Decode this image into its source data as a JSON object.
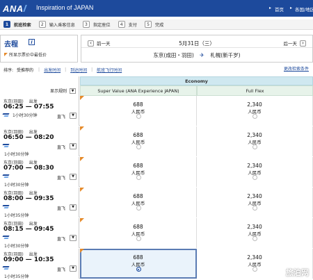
{
  "header": {
    "logo": "ANA",
    "title": "Inspiration of JAPAN",
    "nav_home": "首页",
    "nav_intl": "各国/地区"
  },
  "steps": [
    {
      "num": "1",
      "label": "航班检索",
      "active": true
    },
    {
      "num": "2",
      "label": "输入乘客信息",
      "active": false
    },
    {
      "num": "3",
      "label": "指定座位",
      "active": false
    },
    {
      "num": "4",
      "label": "支付",
      "active": false
    },
    {
      "num": "5",
      "label": "完成",
      "active": false
    }
  ],
  "outbound": {
    "title": "去程",
    "info_icon": "i",
    "lowfare_note": "所显示票价中最低价"
  },
  "date_bar": {
    "prev_label": "前一天",
    "next_label": "后一天",
    "current_date": "5月31日（三）",
    "origin": "东京(成田・羽田)",
    "destination": "札幌(新千岁)"
  },
  "sort_bar": {
    "label": "排序:",
    "current": "受推荐的",
    "links": [
      "出发时间",
      "到达时间",
      "航班飞行时间"
    ],
    "more": "更改检索条件"
  },
  "table": {
    "show_rule_label": "显示规则",
    "cabin": "Economy",
    "fare_types": [
      "Super Value (ANA Experience JAPAN)",
      "Full Flex"
    ]
  },
  "flights": [
    {
      "origin": "东京(羽田)",
      "kind": "出发",
      "times": "06:25 — 07:55",
      "nonstop": "直飞",
      "duration": "1小时30分钟",
      "super_price": "688",
      "super_currency": "人民币",
      "flex_price": "2,340",
      "flex_currency": "人民币"
    },
    {
      "origin": "东京(羽田)",
      "kind": "出发",
      "times": "06:50 — 08:20",
      "nonstop": "直飞",
      "duration": "1小时30分钟",
      "super_price": "688",
      "super_currency": "人民币",
      "flex_price": "2,340",
      "flex_currency": "人民币"
    },
    {
      "origin": "东京(羽田)",
      "kind": "出发",
      "times": "07:00 — 08:30",
      "nonstop": "直飞",
      "duration": "1小时30分钟",
      "super_price": "688",
      "super_currency": "人民币",
      "flex_price": "2,340",
      "flex_currency": "人民币"
    },
    {
      "origin": "东京(羽田)",
      "kind": "出发",
      "times": "08:00 — 09:35",
      "nonstop": "直飞",
      "duration": "1小时35分钟",
      "super_price": "688",
      "super_currency": "人民币",
      "flex_price": "2,340",
      "flex_currency": "人民币"
    },
    {
      "origin": "东京(羽田)",
      "kind": "出发",
      "times": "08:15 — 09:45",
      "nonstop": "直飞",
      "duration": "1小时30分钟",
      "super_price": "688",
      "super_currency": "人民币",
      "flex_price": "2,340",
      "flex_currency": "人民币"
    },
    {
      "origin": "东京(羽田)",
      "kind": "出发",
      "times": "09:00 — 10:35",
      "nonstop": "直飞",
      "duration": "1小时35分钟",
      "super_price": "688",
      "super_currency": "人民币",
      "flex_price": "2,340",
      "flex_currency": "人民币"
    }
  ],
  "watermark": "旅泊网"
}
